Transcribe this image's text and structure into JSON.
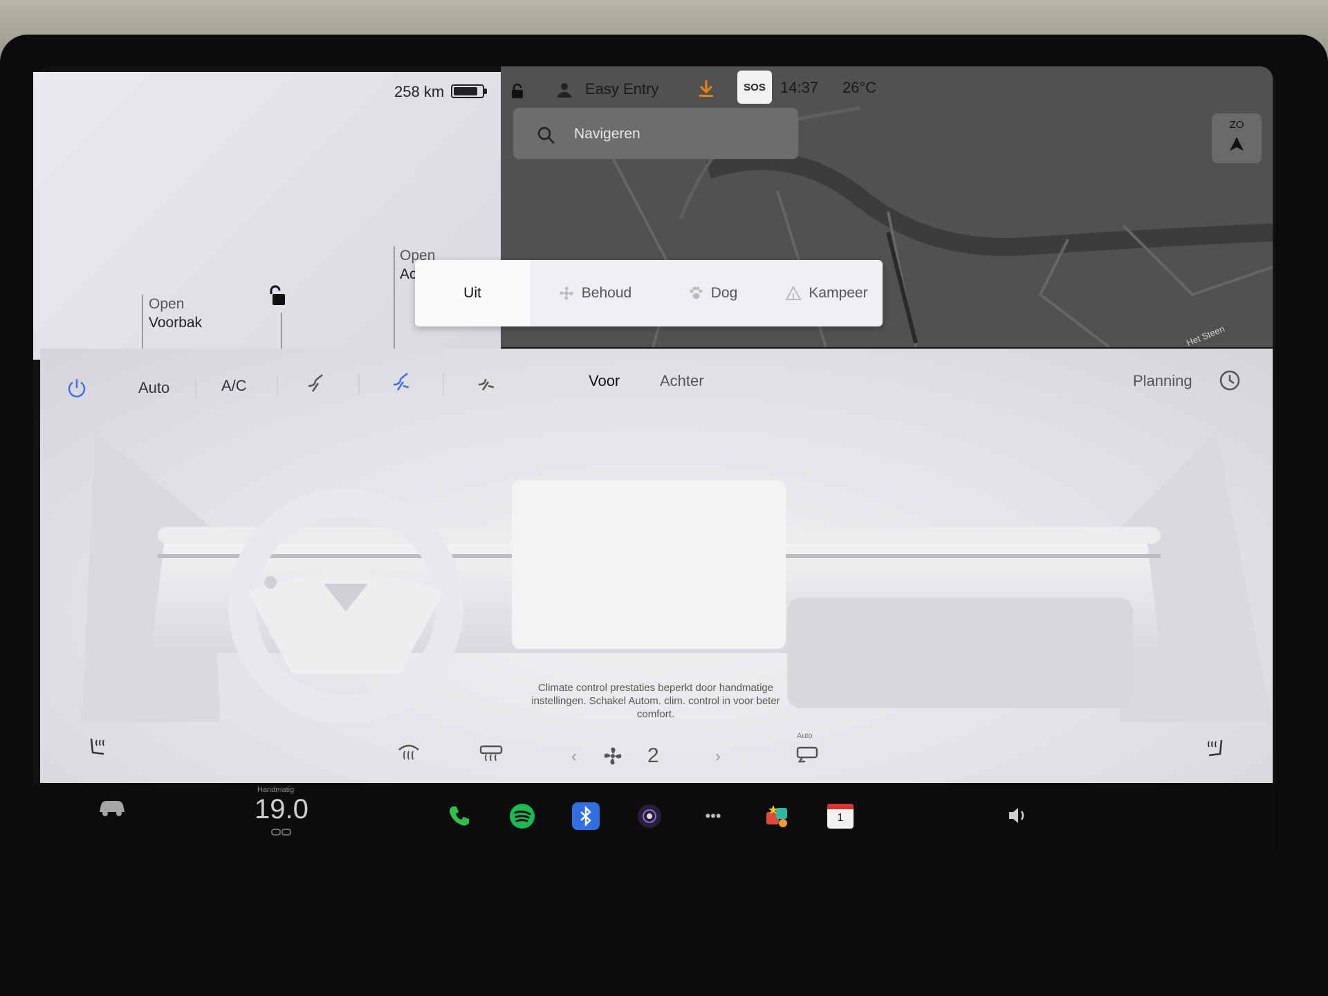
{
  "status": {
    "range": "258 km",
    "battery_level": 0.85,
    "profile": "Easy Entry",
    "sos_label": "SOS",
    "time": "14:37",
    "outside_temp": "26°C"
  },
  "car_panel": {
    "frunk_open_top": "Open",
    "frunk_label": "Voorbak",
    "trunk_open_top": "Open",
    "trunk_label_partial": "Ac"
  },
  "map": {
    "search_placeholder": "Navigeren",
    "compass_label": "ZO",
    "street_label": "Het Steen"
  },
  "camp_modes": {
    "items": [
      {
        "label": "Uit",
        "active": true
      },
      {
        "label": "Behoud",
        "active": false
      },
      {
        "label": "Dog",
        "active": false
      },
      {
        "label": "Kampeer",
        "active": false
      }
    ]
  },
  "climate": {
    "auto_label": "Auto",
    "ac_label": "A/C",
    "front_label": "Voor",
    "rear_label": "Achter",
    "schedule_label": "Planning",
    "warning_text": "Climate control prestaties beperkt door handmatige instellingen. Schakel Autom. clim. control in voor beter comfort.",
    "fan_speed": "2",
    "recirc_label": "Auto",
    "accent": "#3e6ee8"
  },
  "dock": {
    "temp_mode": "Handmatig",
    "temperature": "19.0",
    "calendar_day": "1",
    "phone_color": "#2fbf4a",
    "spotify_color": "#1db954",
    "bluetooth_color": "#2f6fe0"
  }
}
